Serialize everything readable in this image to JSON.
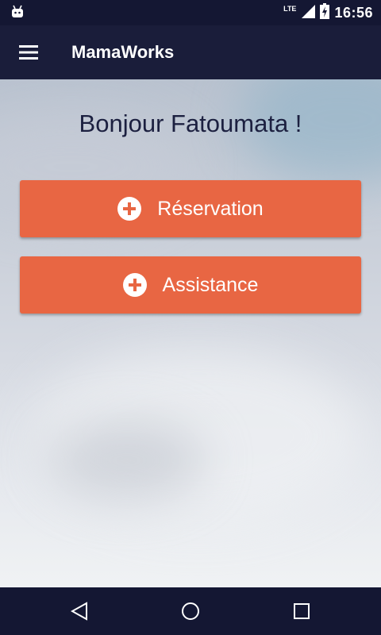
{
  "status_bar": {
    "network": "LTE",
    "time": "16:56",
    "icons": [
      "android-icon",
      "signal-icon",
      "battery-charging-icon"
    ]
  },
  "app_bar": {
    "title": "MamaWorks",
    "menu_icon": "hamburger-menu-icon"
  },
  "main": {
    "greeting": "Bonjour Fatoumata !",
    "buttons": [
      {
        "label": "Réservation",
        "icon": "plus-circle-icon"
      },
      {
        "label": "Assistance",
        "icon": "plus-circle-icon"
      }
    ]
  },
  "nav_bar": {
    "icons": [
      "back-icon",
      "home-icon",
      "recents-icon"
    ]
  },
  "colors": {
    "primary_dark": "#141733",
    "primary": "#1a1d3a",
    "accent": "#e86643"
  }
}
